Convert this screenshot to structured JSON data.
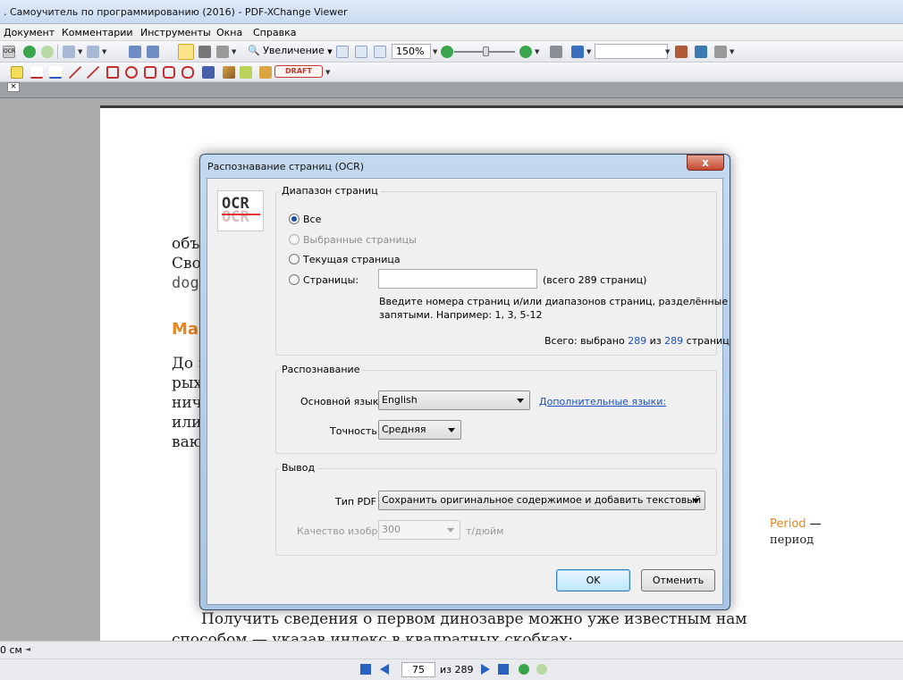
{
  "window": {
    "title": ". Самоучитель по программированию (2016) - PDF-XChange Viewer"
  },
  "menu": [
    "Документ",
    "Комментарии",
    "Инструменты",
    "Окна",
    "Справка"
  ],
  "toolbar": {
    "zoom_label": "Увеличение",
    "zoom_value": "150%",
    "draft_stamp": "DRAFT"
  },
  "tab": {
    "close_glyph": "×"
  },
  "document": {
    "lines": [
      "объ",
      "Сво",
      "dog"
    ],
    "heading": "Ма",
    "para": [
      "До з",
      "рых",
      "нич",
      "или",
      "ваю"
    ],
    "side_term": "Period",
    "side_dash": " —",
    "side_translation": "период",
    "bottom_line1": "Получить сведения о первом динозавре можно уже известным нам",
    "bottom_line2": "способом — указав индекс в квадратных скобках:"
  },
  "status": {
    "units": "0 см"
  },
  "navigation": {
    "current_page": "75",
    "of_pages": "из 289"
  },
  "dialog": {
    "title": "Распознавание страниц (OCR)",
    "close_glyph": "x",
    "logo_text": "OCR",
    "range": {
      "label": "Диапазон страниц",
      "opt_all": "Все",
      "opt_selected": "Выбранные страницы",
      "opt_current": "Текущая страница",
      "opt_pages": "Страницы:",
      "pages_value": "",
      "total_hint": "(всего 289 страниц)",
      "help_line1": "Введите номера страниц и/или диапазонов страниц, разделённые",
      "help_line2": "запятыми. Например: 1, 3, 5-12",
      "summary_prefix": "Всего: выбрано ",
      "summary_selected": "289",
      "summary_mid": " из ",
      "summary_total": "289",
      "summary_suffix": " страниц"
    },
    "recognition": {
      "label": "Распознавание",
      "language_label": "Основной язык:",
      "language_value": "English",
      "more_languages_link": "Дополнительные языки:",
      "accuracy_label": "Точность:",
      "accuracy_value": "Средняя"
    },
    "output": {
      "label": "Вывод",
      "pdf_type_label": "Тип PDF",
      "pdf_type_value": "Сохранить оригинальное содержимое и добавить текстовый слой",
      "quality_label": "Качество изобр.:",
      "quality_value": "300",
      "quality_unit": "т/дюйм"
    },
    "ok_button": "OK",
    "cancel_button": "Отменить"
  }
}
